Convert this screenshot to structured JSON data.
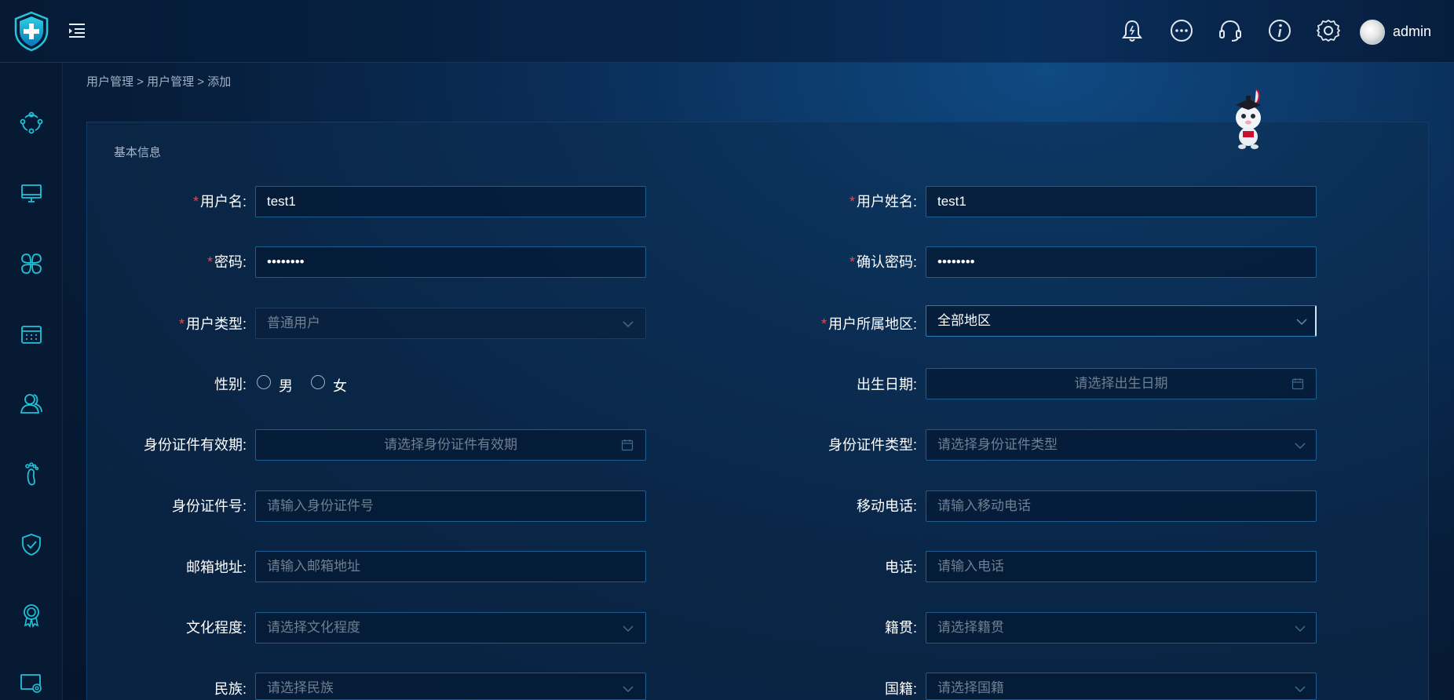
{
  "header": {
    "username": "admin",
    "icons": [
      "bell-icon",
      "more-icon",
      "headset-icon",
      "info-icon",
      "gear-icon"
    ]
  },
  "sidebar": {
    "icons": [
      "network-icon",
      "monitor-icon",
      "apps-icon",
      "calendar-icon",
      "users-icon",
      "footprint-icon",
      "shield-check-icon",
      "award-icon",
      "screen-settings-icon"
    ]
  },
  "breadcrumb": {
    "item1": "用户管理",
    "sep1": " > ",
    "item2": "用户管理",
    "sep2": " > ",
    "item3": "添加"
  },
  "section": {
    "title": "基本信息"
  },
  "form": {
    "required_mark": "*",
    "username": {
      "label": "用户名:",
      "value": "test1"
    },
    "realname": {
      "label": "用户姓名:",
      "value": "test1"
    },
    "password": {
      "label": "密码:",
      "value": "••••••••"
    },
    "confirm_password": {
      "label": "确认密码:",
      "value": "••••••••"
    },
    "user_type": {
      "label": "用户类型:",
      "value": "普通用户"
    },
    "region": {
      "label": "用户所属地区:",
      "value": "全部地区"
    },
    "gender": {
      "label": "性别:",
      "options": [
        "男",
        "女"
      ]
    },
    "birthdate": {
      "label": "出生日期:",
      "placeholder": "请选择出生日期"
    },
    "id_validity": {
      "label": "身份证件有效期:",
      "placeholder": "请选择身份证件有效期"
    },
    "id_type": {
      "label": "身份证件类型:",
      "placeholder": "请选择身份证件类型"
    },
    "id_number": {
      "label": "身份证件号:",
      "placeholder": "请输入身份证件号"
    },
    "mobile": {
      "label": "移动电话:",
      "placeholder": "请输入移动电话"
    },
    "email": {
      "label": "邮箱地址:",
      "placeholder": "请输入邮箱地址"
    },
    "phone": {
      "label": "电话:",
      "placeholder": "请输入电话"
    },
    "education": {
      "label": "文化程度:",
      "placeholder": "请选择文化程度"
    },
    "native_place": {
      "label": "籍贯:",
      "placeholder": "请选择籍贯"
    },
    "ethnicity": {
      "label": "民族:",
      "placeholder": "请选择民族"
    },
    "nationality": {
      "label": "国籍:",
      "placeholder": "请选择国籍"
    }
  },
  "colors": {
    "accent": "#1ec3d8",
    "required": "#e8474c",
    "border": "#1d5e92"
  }
}
